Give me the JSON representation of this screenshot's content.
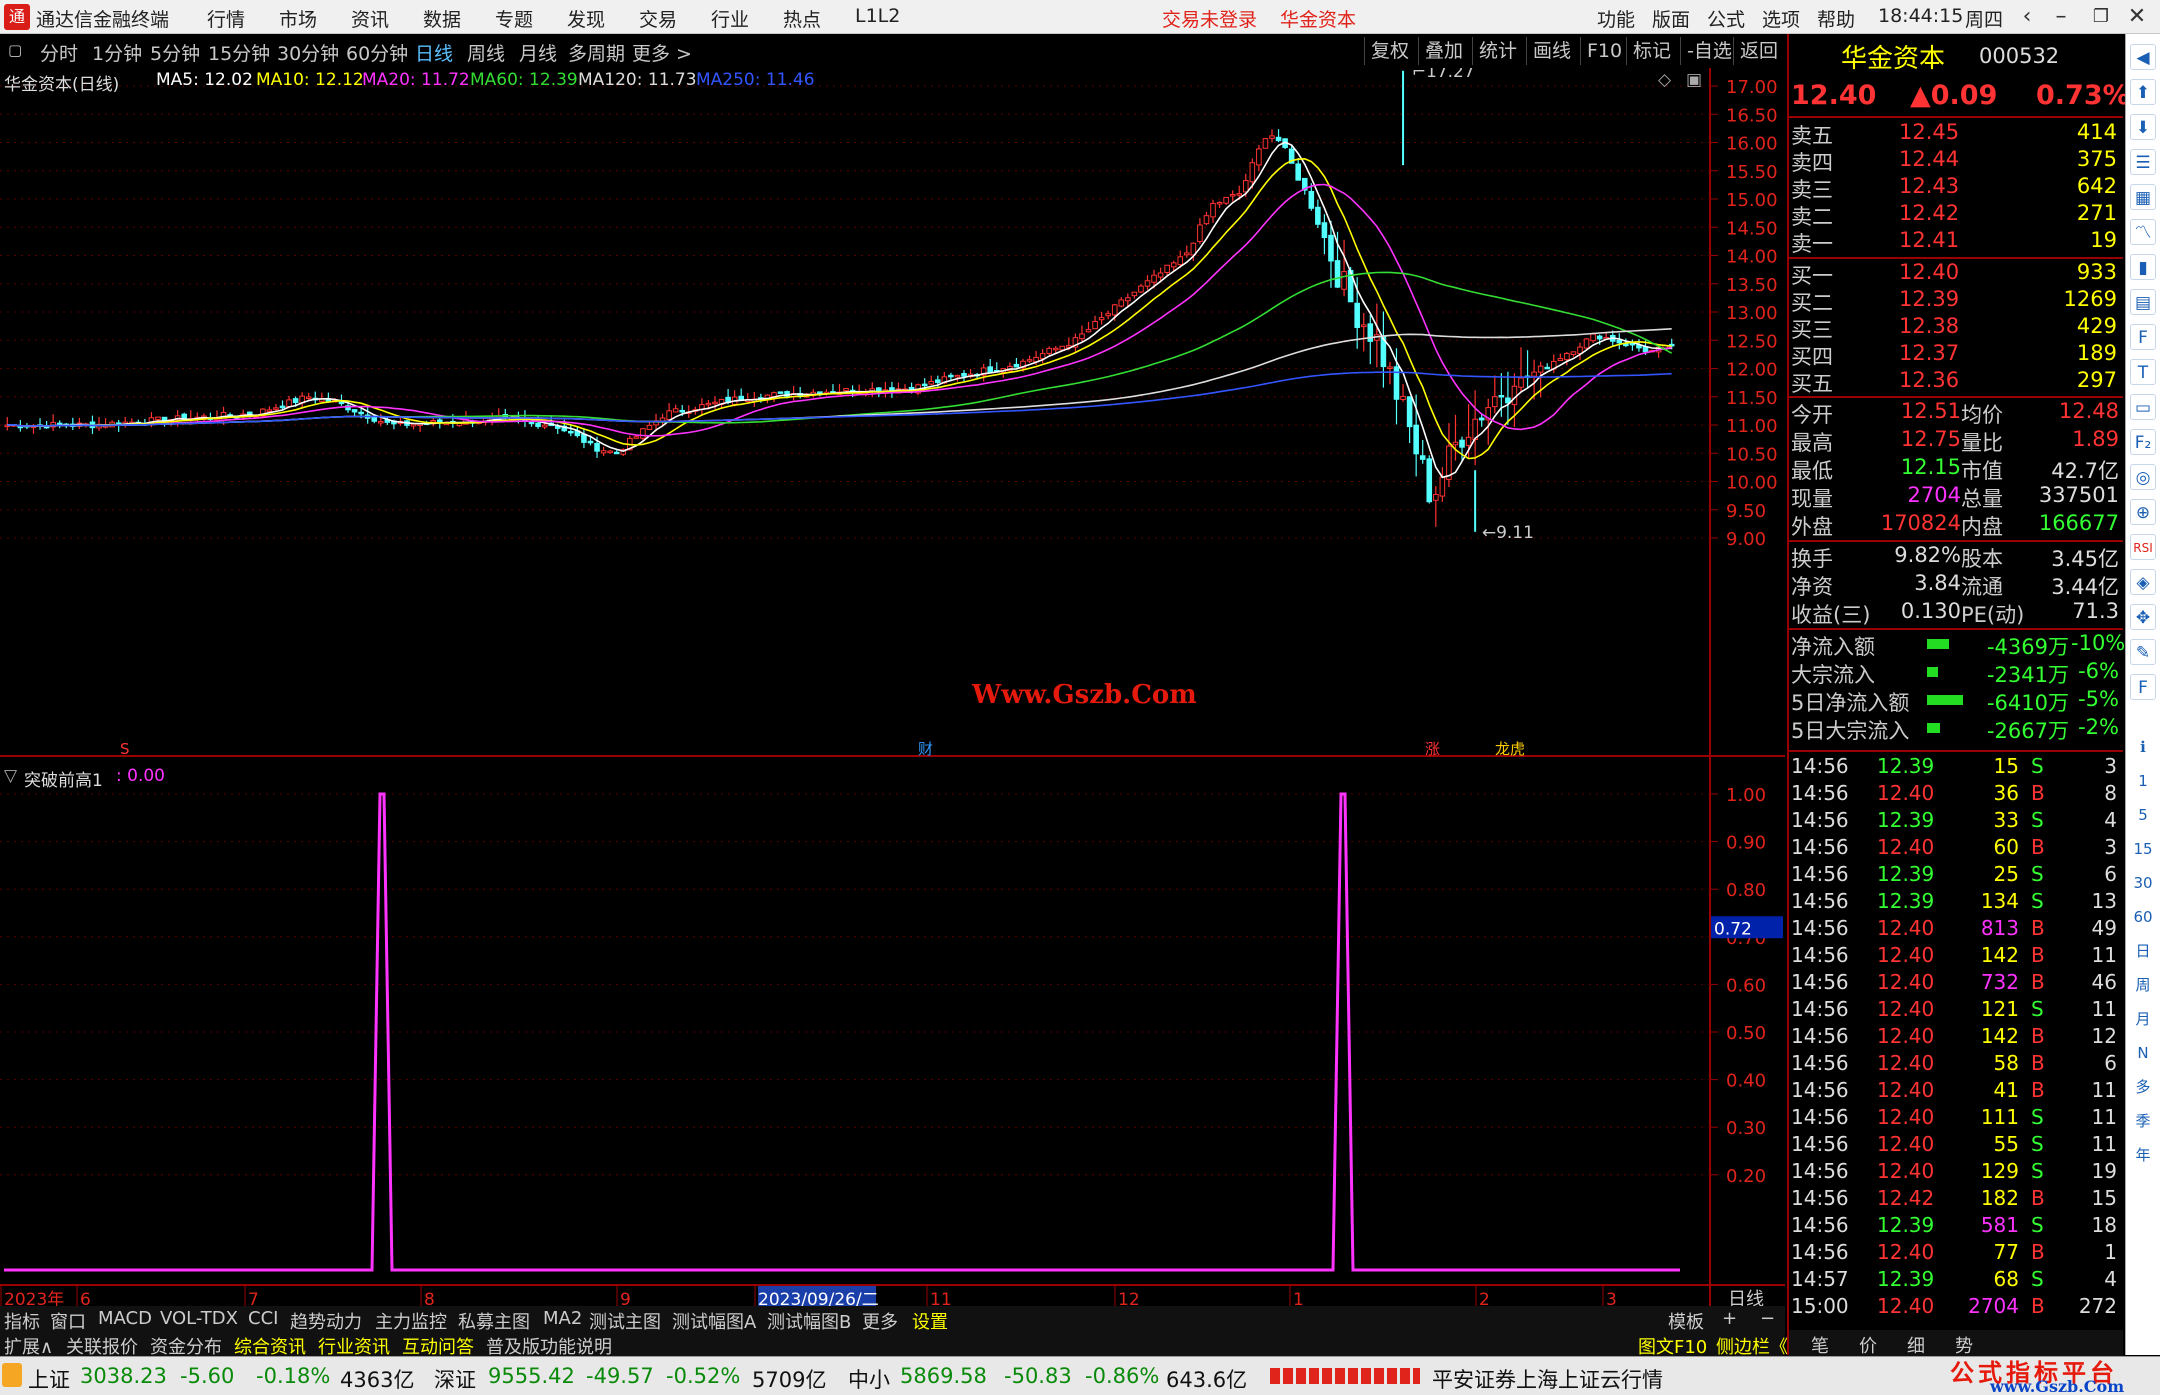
{
  "window": {
    "title": "通达信金融终端",
    "logo": "通",
    "menu": [
      "行情",
      "市场",
      "资讯",
      "数据",
      "专题",
      "发现",
      "交易",
      "行业",
      "热点",
      "L1L2"
    ],
    "login_status": "交易未登录",
    "broker": "华金资本",
    "right_menu": [
      "功能",
      "版面",
      "公式",
      "选项",
      "帮助"
    ],
    "time": "18:44:15",
    "weekday": "周四"
  },
  "toolbar": {
    "periods": [
      "分时",
      "1分钟",
      "5分钟",
      "15分钟",
      "30分钟",
      "60分钟",
      "日线",
      "周线",
      "月线",
      "多周期",
      "更多 >"
    ],
    "selected": "日线",
    "right_buttons": [
      "复权",
      "叠加",
      "统计",
      "画线",
      "F10",
      "标记",
      "-自选",
      "返回"
    ]
  },
  "main_chart": {
    "title": "华金资本(日线)",
    "ma_labels": [
      {
        "text": "MA5: 12.02",
        "color": "#ffffff"
      },
      {
        "text": "MA10: 12.12",
        "color": "#ffff00"
      },
      {
        "text": "MA20: 11.72",
        "color": "#ff33ff"
      },
      {
        "text": "MA60: 12.39",
        "color": "#33dd33"
      },
      {
        "text": "MA120: 11.73",
        "color": "#dddddd"
      },
      {
        "text": "MA250: 11.46",
        "color": "#3355ff"
      }
    ],
    "high_label": "17.27",
    "low_label": "9.11",
    "y_ticks": [
      "17.00",
      "16.50",
      "16.00",
      "15.50",
      "15.00",
      "14.50",
      "14.00",
      "13.50",
      "13.00",
      "12.50",
      "12.00",
      "11.50",
      "11.00",
      "10.50",
      "10.00",
      "9.50",
      "9.00"
    ],
    "markers": [
      {
        "text": "S",
        "color": "#ff3333"
      },
      {
        "text": "财",
        "color": "#3399ff"
      },
      {
        "text": "涨",
        "color": "#ff3333"
      },
      {
        "text": "龙虎",
        "color": "#ffcc00"
      }
    ],
    "watermark": "Www.Gszb.Com"
  },
  "indicator": {
    "name": "突破前高1",
    "value": ": 0.00",
    "y_ticks": [
      "1.00",
      "0.90",
      "0.80",
      "0.70",
      "0.60",
      "0.50",
      "0.40",
      "0.30",
      "0.20"
    ],
    "cursor_value": "0.72"
  },
  "chart_data": {
    "type": "line",
    "name": "突破前高1",
    "x": [
      "2023/09/26/二"
    ],
    "ylim": [
      0,
      1
    ],
    "spikes": [
      {
        "month": "7",
        "value": 1.0
      },
      {
        "month": "1",
        "value": 1.0
      }
    ],
    "baseline": 0.0
  },
  "x_axis": {
    "labels": [
      "2023年",
      "6",
      "7",
      "8",
      "9",
      "2023/09/26/二",
      "11",
      "12",
      "1",
      "2",
      "3"
    ],
    "period_label": "日线"
  },
  "bottom_tabs": [
    "指标",
    "窗口",
    "MACD",
    "VOL-TDX",
    "CCI",
    "趋势动力",
    "主力监控",
    "私募主图",
    "MA2",
    "测试主图",
    "测试幅图A",
    "测试幅图B",
    "更多",
    "设置"
  ],
  "bottom_right": [
    "模板",
    "+",
    "−"
  ],
  "bottom_tabs2": [
    "扩展∧",
    "关联报价",
    "资金分布",
    "综合资讯",
    "行业资讯",
    "互动问答",
    "普及版功能说明"
  ],
  "bottom_tabs2_right": [
    "图文F10",
    "侧边栏《"
  ],
  "stock": {
    "name": "华金资本",
    "code": "000532",
    "price": "12.40",
    "change": "▲0.09",
    "pct": "0.73%"
  },
  "asks": [
    {
      "label": "卖五",
      "price": "12.45",
      "vol": "414"
    },
    {
      "label": "卖四",
      "price": "12.44",
      "vol": "375"
    },
    {
      "label": "卖三",
      "price": "12.43",
      "vol": "642"
    },
    {
      "label": "卖二",
      "price": "12.42",
      "vol": "271"
    },
    {
      "label": "卖一",
      "price": "12.41",
      "vol": "19"
    }
  ],
  "bids": [
    {
      "label": "买一",
      "price": "12.40",
      "vol": "933"
    },
    {
      "label": "买二",
      "price": "12.39",
      "vol": "1269"
    },
    {
      "label": "买三",
      "price": "12.38",
      "vol": "429"
    },
    {
      "label": "买四",
      "price": "12.37",
      "vol": "189"
    },
    {
      "label": "买五",
      "price": "12.36",
      "vol": "297"
    }
  ],
  "quote": [
    {
      "l1": "今开",
      "v1": "12.51",
      "c1": "#ff3333",
      "l2": "均价",
      "v2": "12.48",
      "c2": "#ff3333"
    },
    {
      "l1": "最高",
      "v1": "12.75",
      "c1": "#ff3333",
      "l2": "量比",
      "v2": "1.89",
      "c2": "#ff3333"
    },
    {
      "l1": "最低",
      "v1": "12.15",
      "c1": "#33ff33",
      "l2": "市值",
      "v2": "42.7亿",
      "c2": "#dddddd"
    },
    {
      "l1": "现量",
      "v1": "2704",
      "c1": "#ff33ff",
      "l2": "总量",
      "v2": "337501",
      "c2": "#dddddd"
    },
    {
      "l1": "外盘",
      "v1": "170824",
      "c1": "#ff3333",
      "l2": "内盘",
      "v2": "166677",
      "c2": "#33ff33"
    }
  ],
  "fundamentals": [
    {
      "l1": "换手",
      "v1": "9.82%",
      "l2": "股本",
      "v2": "3.45亿"
    },
    {
      "l1": "净资",
      "v1": "3.84",
      "l2": "流通",
      "v2": "3.44亿"
    },
    {
      "l1": "收益(三)",
      "v1": "0.130",
      "l2": "PE(动)",
      "v2": "71.3"
    }
  ],
  "flows": [
    {
      "label": "净流入额",
      "bar": 0.6,
      "amount": "-4369万",
      "pct": "-10%"
    },
    {
      "label": "大宗流入",
      "bar": 0.3,
      "amount": "-2341万",
      "pct": "-6%"
    },
    {
      "label": "5日净流入额",
      "bar": 1.0,
      "amount": "-6410万",
      "pct": "-5%"
    },
    {
      "label": "5日大宗流入",
      "bar": 0.35,
      "amount": "-2667万",
      "pct": "-2%"
    }
  ],
  "ticks": [
    {
      "t": "14:56",
      "p": "12.39",
      "pc": "#33ff33",
      "v": "15",
      "vc": "#ffff00",
      "bs": "S",
      "n": "3"
    },
    {
      "t": "14:56",
      "p": "12.40",
      "pc": "#ff3333",
      "v": "36",
      "vc": "#ffff00",
      "bs": "B",
      "n": "8"
    },
    {
      "t": "14:56",
      "p": "12.39",
      "pc": "#33ff33",
      "v": "33",
      "vc": "#ffff00",
      "bs": "S",
      "n": "4"
    },
    {
      "t": "14:56",
      "p": "12.40",
      "pc": "#ff3333",
      "v": "60",
      "vc": "#ffff00",
      "bs": "B",
      "n": "3"
    },
    {
      "t": "14:56",
      "p": "12.39",
      "pc": "#33ff33",
      "v": "25",
      "vc": "#ffff00",
      "bs": "S",
      "n": "6"
    },
    {
      "t": "14:56",
      "p": "12.39",
      "pc": "#33ff33",
      "v": "134",
      "vc": "#ffff00",
      "bs": "S",
      "n": "13"
    },
    {
      "t": "14:56",
      "p": "12.40",
      "pc": "#ff3333",
      "v": "813",
      "vc": "#ff33ff",
      "bs": "B",
      "n": "49"
    },
    {
      "t": "14:56",
      "p": "12.40",
      "pc": "#ff3333",
      "v": "142",
      "vc": "#ffff00",
      "bs": "B",
      "n": "11"
    },
    {
      "t": "14:56",
      "p": "12.40",
      "pc": "#ff3333",
      "v": "732",
      "vc": "#ff33ff",
      "bs": "B",
      "n": "46"
    },
    {
      "t": "14:56",
      "p": "12.40",
      "pc": "#ff3333",
      "v": "121",
      "vc": "#ffff00",
      "bs": "S",
      "n": "11"
    },
    {
      "t": "14:56",
      "p": "12.40",
      "pc": "#ff3333",
      "v": "142",
      "vc": "#ffff00",
      "bs": "B",
      "n": "12"
    },
    {
      "t": "14:56",
      "p": "12.40",
      "pc": "#ff3333",
      "v": "58",
      "vc": "#ffff00",
      "bs": "B",
      "n": "6"
    },
    {
      "t": "14:56",
      "p": "12.40",
      "pc": "#ff3333",
      "v": "41",
      "vc": "#ffff00",
      "bs": "B",
      "n": "11"
    },
    {
      "t": "14:56",
      "p": "12.40",
      "pc": "#ff3333",
      "v": "111",
      "vc": "#ffff00",
      "bs": "S",
      "n": "11"
    },
    {
      "t": "14:56",
      "p": "12.40",
      "pc": "#ff3333",
      "v": "55",
      "vc": "#ffff00",
      "bs": "S",
      "n": "11"
    },
    {
      "t": "14:56",
      "p": "12.40",
      "pc": "#ff3333",
      "v": "129",
      "vc": "#ffff00",
      "bs": "S",
      "n": "19"
    },
    {
      "t": "14:56",
      "p": "12.42",
      "pc": "#ff3333",
      "v": "182",
      "vc": "#ffff00",
      "bs": "B",
      "n": "15"
    },
    {
      "t": "14:56",
      "p": "12.39",
      "pc": "#33ff33",
      "v": "581",
      "vc": "#ff33ff",
      "bs": "S",
      "n": "18"
    },
    {
      "t": "14:56",
      "p": "12.40",
      "pc": "#ff3333",
      "v": "77",
      "vc": "#ffff00",
      "bs": "B",
      "n": "1"
    },
    {
      "t": "14:57",
      "p": "12.39",
      "pc": "#33ff33",
      "v": "68",
      "vc": "#ffff00",
      "bs": "S",
      "n": "4"
    },
    {
      "t": "15:00",
      "p": "12.40",
      "pc": "#ff3333",
      "v": "2704",
      "vc": "#ff33ff",
      "bs": "B",
      "n": "272"
    }
  ],
  "right_bottom_tabs": [
    "笔",
    "价",
    "细",
    "势"
  ],
  "side_icons": [
    "ℹ",
    "1",
    "5",
    "15",
    "30",
    "60",
    "日",
    "周",
    "月",
    "N",
    "多",
    "季",
    "年"
  ],
  "side_icon_names": [
    "arrow-left-icon",
    "arrow-up-icon",
    "arrow-down-icon",
    "list-icon",
    "grid-icon",
    "line-chart-icon",
    "candle-icon",
    "table-icon",
    "f10-icon",
    "text-icon",
    "doc-icon",
    "f2-icon",
    "compare-icon",
    "globe-icon",
    "rsi-label-icon",
    "chart2-icon",
    "crosshair-icon",
    "pen-icon",
    "fs-icon"
  ],
  "rsi_label": "RSI",
  "status": {
    "indices": [
      {
        "name": "上证",
        "val": "3038.23",
        "chg": "-5.60",
        "pct": "-0.18%",
        "amt": "4363亿"
      },
      {
        "name": "深证",
        "val": "9555.42",
        "chg": "-49.57",
        "pct": "-0.52%",
        "amt": "5709亿"
      },
      {
        "name": "中小",
        "val": "5869.58",
        "chg": "-50.83",
        "pct": "-0.86%",
        "amt": "643.6亿"
      }
    ],
    "server": "平安证券上海上证云行情",
    "watermark": "公式指标平台",
    "watermark_url": "www.Gszb.Com"
  }
}
